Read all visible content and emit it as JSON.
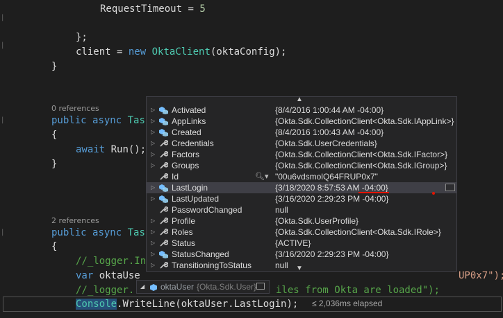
{
  "code": {
    "line_request_timeout_name": "RequestTimeout",
    "line_request_timeout_eq": " = ",
    "line_request_timeout_val": "5",
    "close_brace_semicolon": "};",
    "client_var": "client",
    "assign": " = ",
    "kw_new": "new",
    "okta_client_type": "OktaClient",
    "okta_client_args": "(oktaConfig);",
    "close_brace": "}",
    "open_brace": "{",
    "refs_0": "0 references",
    "refs_2": "2 references",
    "kw_public": "public",
    "kw_async": "async",
    "task_type_partial": "Tas",
    "kw_await": "await",
    "run_call": "Run();",
    "comment_logger1": "//_logger.In",
    "kw_var": "var",
    "okta_user_partial": "oktaUse",
    "str_tail": "UP0x7\");",
    "comment_logger2": "//_logger.",
    "comment_tail": "iles from Okta are loaded\");",
    "console_type": "Console",
    "writeline": ".WriteLine(oktaUser.LastLogin);",
    "elapsed": "≤ 2,036ms elapsed"
  },
  "datatip": {
    "name": "oktaUser",
    "type": "{Okta.Sdk.User}"
  },
  "watch_rows": [
    {
      "name": "Activated",
      "value": "{8/4/2016 1:00:44 AM -04:00}",
      "expandable": true,
      "icon": "property-icon"
    },
    {
      "name": "AppLinks",
      "value": "{Okta.Sdk.CollectionClient<Okta.Sdk.IAppLink>}",
      "expandable": true,
      "icon": "property-icon"
    },
    {
      "name": "Created",
      "value": "{8/4/2016 1:00:43 AM -04:00}",
      "expandable": true,
      "icon": "property-icon"
    },
    {
      "name": "Credentials",
      "value": "{Okta.Sdk.UserCredentials}",
      "expandable": true,
      "icon": "wrench-icon"
    },
    {
      "name": "Factors",
      "value": "{Okta.Sdk.CollectionClient<Okta.Sdk.IFactor>}",
      "expandable": true,
      "icon": "wrench-icon"
    },
    {
      "name": "Groups",
      "value": "{Okta.Sdk.CollectionClient<Okta.Sdk.IGroup>}",
      "expandable": true,
      "icon": "wrench-icon"
    },
    {
      "name": "Id",
      "value": "\"00u6vdsmolQ64FRUP0x7\"",
      "expandable": false,
      "icon": "wrench-icon"
    },
    {
      "name": "LastLogin",
      "value": "{3/18/2020 8:57:53 AM -04:00}",
      "expandable": true,
      "icon": "property-icon"
    },
    {
      "name": "LastUpdated",
      "value": "{3/16/2020 2:29:23 PM -04:00}",
      "expandable": true,
      "icon": "property-icon"
    },
    {
      "name": "PasswordChanged",
      "value": "null",
      "expandable": false,
      "icon": "wrench-icon"
    },
    {
      "name": "Profile",
      "value": "{Okta.Sdk.UserProfile}",
      "expandable": true,
      "icon": "wrench-icon"
    },
    {
      "name": "Roles",
      "value": "{Okta.Sdk.CollectionClient<Okta.Sdk.IRole>}",
      "expandable": true,
      "icon": "wrench-icon"
    },
    {
      "name": "Status",
      "value": "{ACTIVE}",
      "expandable": true,
      "icon": "wrench-icon"
    },
    {
      "name": "StatusChanged",
      "value": "{3/16/2020 2:29:23 PM -04:00}",
      "expandable": true,
      "icon": "property-icon"
    },
    {
      "name": "TransitioningToStatus",
      "value": "null",
      "expandable": true,
      "icon": "wrench-icon"
    }
  ],
  "colors": {
    "editor_bg": "#1e1e1e",
    "keyword": "#569cd6",
    "type": "#4ec9b0",
    "comment": "#57a64a",
    "string": "#d69d85",
    "annotation_red": "#e51400"
  }
}
